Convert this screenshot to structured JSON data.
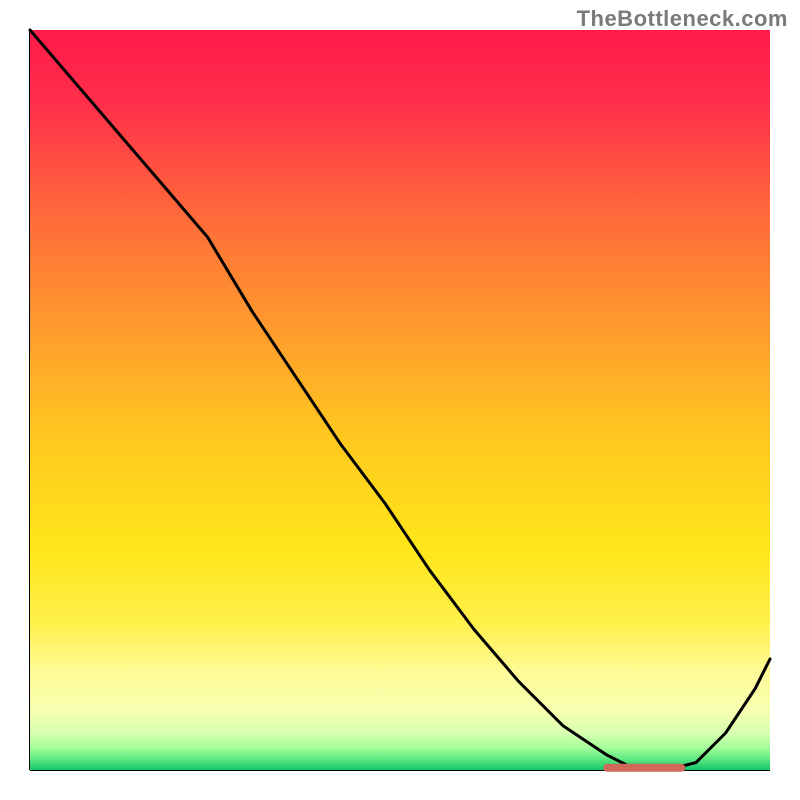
{
  "attribution": "TheBottleneck.com",
  "colors": {
    "curve": "#000000",
    "marker": "#cf6a5a",
    "axis": "#000000",
    "gradient_top": "#ff1a4a",
    "gradient_bottom": "#13c56a"
  },
  "chart_data": {
    "type": "line",
    "title": "",
    "xlabel": "",
    "ylabel": "",
    "xlim": [
      0,
      100
    ],
    "ylim": [
      0,
      100
    ],
    "grid": false,
    "legend": false,
    "series": [
      {
        "name": "bottleneck_curve",
        "x": [
          0,
          6,
          12,
          18,
          24,
          30,
          36,
          42,
          48,
          54,
          60,
          66,
          72,
          78,
          82,
          86,
          90,
          94,
          98,
          100
        ],
        "values": [
          100,
          93,
          86,
          79,
          72,
          62,
          53,
          44,
          36,
          27,
          19,
          12,
          6,
          2,
          0,
          0,
          1,
          5,
          11,
          15
        ]
      }
    ],
    "annotations": [
      {
        "name": "min_marker",
        "x_start": 78,
        "x_end": 88,
        "y": 0.3
      }
    ]
  }
}
